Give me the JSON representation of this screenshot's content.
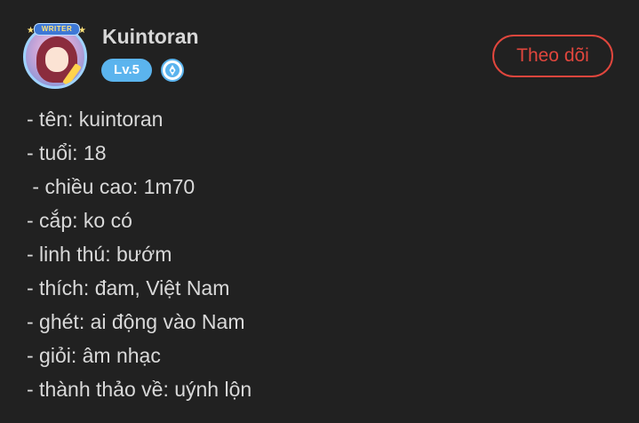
{
  "profile": {
    "name": "Kuintoran",
    "avatar_banner": "WRITER",
    "level": "Lv.5",
    "follow_label": "Theo dõi"
  },
  "icons": {
    "pen_badge": "fountain-pen-icon",
    "stars": "star-icon"
  },
  "colors": {
    "background": "#212121",
    "level_badge": "#5bb4ee",
    "follow_accent": "#e0463d",
    "text": "#d9d9d9"
  },
  "bio": [
    "- tên: kuintoran",
    "- tuổi: 18",
    " - chiều cao: 1m70",
    "- cắp: ko có",
    "- linh thú: bướm",
    "- thích: đam, Việt Nam",
    "- ghét: ai động vào Nam",
    "- giỏi: âm nhạc",
    "- thành thảo về: uýnh lộn"
  ]
}
